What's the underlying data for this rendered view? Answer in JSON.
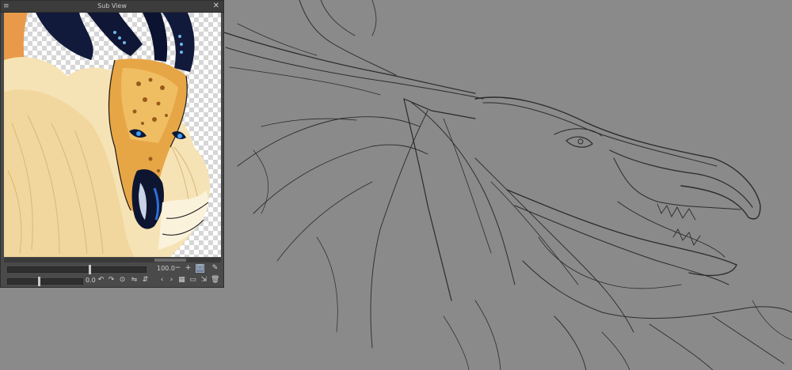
{
  "subview": {
    "title": "Sub View",
    "zoom_value": "100.0",
    "rotation_value": "0.0"
  },
  "icons": {
    "menu": "≡",
    "close": "✕",
    "zoom_out": "−",
    "zoom_in": "+",
    "fit": "⊡",
    "eyedropper": "✎",
    "rotate_left": "↶",
    "rotate_right": "↷",
    "reset": "⊙",
    "flip_horizontal": "⇋",
    "flip_vertical": "⇵",
    "prev": "‹",
    "next": "›",
    "thumbnails": "▦",
    "open": "▭",
    "import": "⇲",
    "delete": "🗑"
  },
  "colors": {
    "canvas_bg": "#8a8a8a",
    "sketch_line": "#2b2b2b",
    "panel_bg": "#4a4a4a"
  }
}
